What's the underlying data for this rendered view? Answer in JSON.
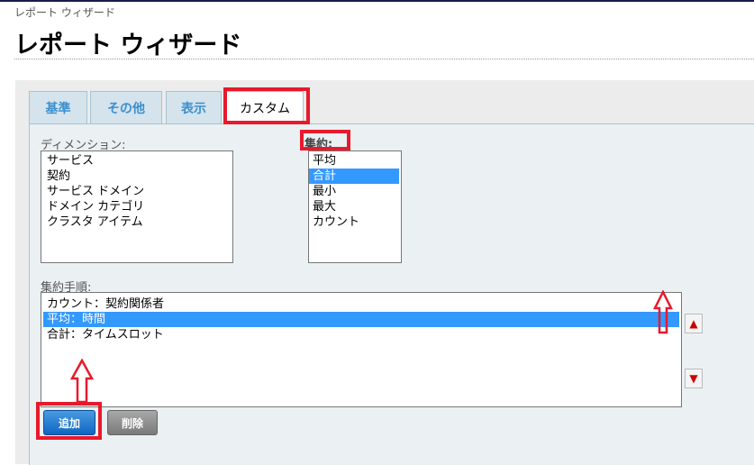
{
  "header": {
    "breadcrumb": "レポート ウィザード",
    "title": "レポート ウィザード"
  },
  "tabs": [
    {
      "label": "基準"
    },
    {
      "label": "その他"
    },
    {
      "label": "表示"
    },
    {
      "label": "カスタム"
    }
  ],
  "dimension": {
    "label": "ディメンション:",
    "items": [
      "サービス",
      "契約",
      "サービス ドメイン",
      "ドメイン カテゴリ",
      "クラスタ アイテム"
    ]
  },
  "aggregate": {
    "label": "集約:",
    "items": [
      "平均",
      "合計",
      "最小",
      "最大",
      "カウント"
    ],
    "selected": "合計"
  },
  "procedure": {
    "label": "集約手順:",
    "items": [
      "カウント：契約関係者",
      "平均：時間",
      "合計：タイムスロット"
    ],
    "selected": "平均：時間"
  },
  "buttons": {
    "add": "追加",
    "delete": "削除"
  }
}
